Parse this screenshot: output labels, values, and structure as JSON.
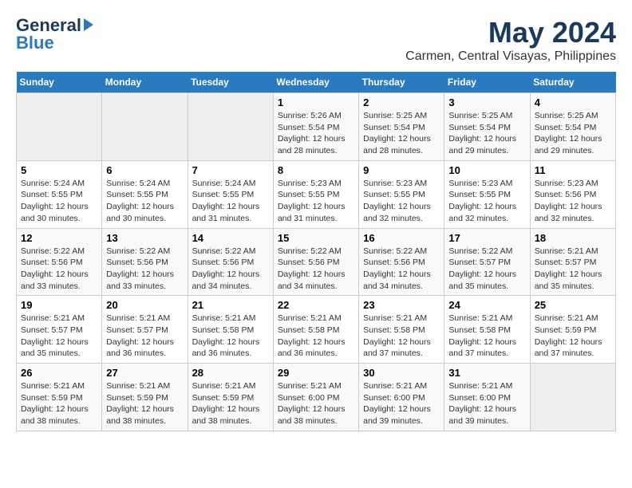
{
  "header": {
    "logo_line1": "General",
    "logo_line2": "Blue",
    "month": "May 2024",
    "location": "Carmen, Central Visayas, Philippines"
  },
  "weekdays": [
    "Sunday",
    "Monday",
    "Tuesday",
    "Wednesday",
    "Thursday",
    "Friday",
    "Saturday"
  ],
  "weeks": [
    [
      {
        "day": "",
        "info": ""
      },
      {
        "day": "",
        "info": ""
      },
      {
        "day": "",
        "info": ""
      },
      {
        "day": "1",
        "info": "Sunrise: 5:26 AM\nSunset: 5:54 PM\nDaylight: 12 hours\nand 28 minutes."
      },
      {
        "day": "2",
        "info": "Sunrise: 5:25 AM\nSunset: 5:54 PM\nDaylight: 12 hours\nand 28 minutes."
      },
      {
        "day": "3",
        "info": "Sunrise: 5:25 AM\nSunset: 5:54 PM\nDaylight: 12 hours\nand 29 minutes."
      },
      {
        "day": "4",
        "info": "Sunrise: 5:25 AM\nSunset: 5:54 PM\nDaylight: 12 hours\nand 29 minutes."
      }
    ],
    [
      {
        "day": "5",
        "info": "Sunrise: 5:24 AM\nSunset: 5:55 PM\nDaylight: 12 hours\nand 30 minutes."
      },
      {
        "day": "6",
        "info": "Sunrise: 5:24 AM\nSunset: 5:55 PM\nDaylight: 12 hours\nand 30 minutes."
      },
      {
        "day": "7",
        "info": "Sunrise: 5:24 AM\nSunset: 5:55 PM\nDaylight: 12 hours\nand 31 minutes."
      },
      {
        "day": "8",
        "info": "Sunrise: 5:23 AM\nSunset: 5:55 PM\nDaylight: 12 hours\nand 31 minutes."
      },
      {
        "day": "9",
        "info": "Sunrise: 5:23 AM\nSunset: 5:55 PM\nDaylight: 12 hours\nand 32 minutes."
      },
      {
        "day": "10",
        "info": "Sunrise: 5:23 AM\nSunset: 5:55 PM\nDaylight: 12 hours\nand 32 minutes."
      },
      {
        "day": "11",
        "info": "Sunrise: 5:23 AM\nSunset: 5:56 PM\nDaylight: 12 hours\nand 32 minutes."
      }
    ],
    [
      {
        "day": "12",
        "info": "Sunrise: 5:22 AM\nSunset: 5:56 PM\nDaylight: 12 hours\nand 33 minutes."
      },
      {
        "day": "13",
        "info": "Sunrise: 5:22 AM\nSunset: 5:56 PM\nDaylight: 12 hours\nand 33 minutes."
      },
      {
        "day": "14",
        "info": "Sunrise: 5:22 AM\nSunset: 5:56 PM\nDaylight: 12 hours\nand 34 minutes."
      },
      {
        "day": "15",
        "info": "Sunrise: 5:22 AM\nSunset: 5:56 PM\nDaylight: 12 hours\nand 34 minutes."
      },
      {
        "day": "16",
        "info": "Sunrise: 5:22 AM\nSunset: 5:56 PM\nDaylight: 12 hours\nand 34 minutes."
      },
      {
        "day": "17",
        "info": "Sunrise: 5:22 AM\nSunset: 5:57 PM\nDaylight: 12 hours\nand 35 minutes."
      },
      {
        "day": "18",
        "info": "Sunrise: 5:21 AM\nSunset: 5:57 PM\nDaylight: 12 hours\nand 35 minutes."
      }
    ],
    [
      {
        "day": "19",
        "info": "Sunrise: 5:21 AM\nSunset: 5:57 PM\nDaylight: 12 hours\nand 35 minutes."
      },
      {
        "day": "20",
        "info": "Sunrise: 5:21 AM\nSunset: 5:57 PM\nDaylight: 12 hours\nand 36 minutes."
      },
      {
        "day": "21",
        "info": "Sunrise: 5:21 AM\nSunset: 5:58 PM\nDaylight: 12 hours\nand 36 minutes."
      },
      {
        "day": "22",
        "info": "Sunrise: 5:21 AM\nSunset: 5:58 PM\nDaylight: 12 hours\nand 36 minutes."
      },
      {
        "day": "23",
        "info": "Sunrise: 5:21 AM\nSunset: 5:58 PM\nDaylight: 12 hours\nand 37 minutes."
      },
      {
        "day": "24",
        "info": "Sunrise: 5:21 AM\nSunset: 5:58 PM\nDaylight: 12 hours\nand 37 minutes."
      },
      {
        "day": "25",
        "info": "Sunrise: 5:21 AM\nSunset: 5:59 PM\nDaylight: 12 hours\nand 37 minutes."
      }
    ],
    [
      {
        "day": "26",
        "info": "Sunrise: 5:21 AM\nSunset: 5:59 PM\nDaylight: 12 hours\nand 38 minutes."
      },
      {
        "day": "27",
        "info": "Sunrise: 5:21 AM\nSunset: 5:59 PM\nDaylight: 12 hours\nand 38 minutes."
      },
      {
        "day": "28",
        "info": "Sunrise: 5:21 AM\nSunset: 5:59 PM\nDaylight: 12 hours\nand 38 minutes."
      },
      {
        "day": "29",
        "info": "Sunrise: 5:21 AM\nSunset: 6:00 PM\nDaylight: 12 hours\nand 38 minutes."
      },
      {
        "day": "30",
        "info": "Sunrise: 5:21 AM\nSunset: 6:00 PM\nDaylight: 12 hours\nand 39 minutes."
      },
      {
        "day": "31",
        "info": "Sunrise: 5:21 AM\nSunset: 6:00 PM\nDaylight: 12 hours\nand 39 minutes."
      },
      {
        "day": "",
        "info": ""
      }
    ]
  ]
}
